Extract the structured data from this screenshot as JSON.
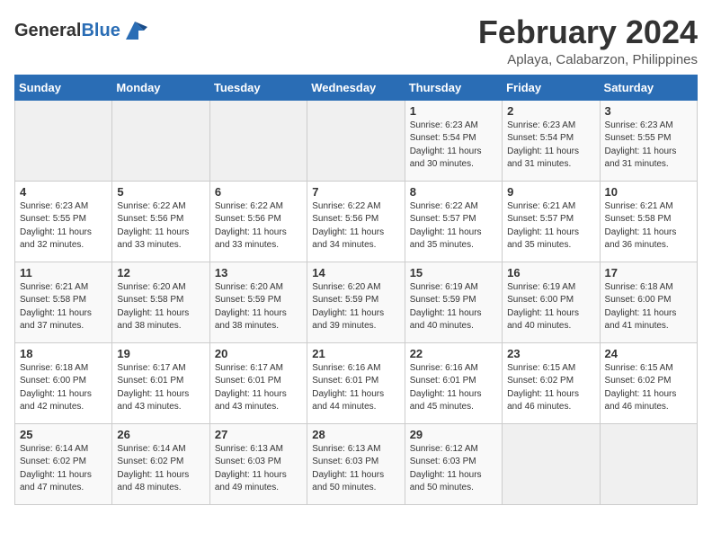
{
  "header": {
    "logo_general": "General",
    "logo_blue": "Blue",
    "title": "February 2024",
    "subtitle": "Aplaya, Calabarzon, Philippines"
  },
  "weekdays": [
    "Sunday",
    "Monday",
    "Tuesday",
    "Wednesday",
    "Thursday",
    "Friday",
    "Saturday"
  ],
  "weeks": [
    [
      {
        "day": "",
        "info": ""
      },
      {
        "day": "",
        "info": ""
      },
      {
        "day": "",
        "info": ""
      },
      {
        "day": "",
        "info": ""
      },
      {
        "day": "1",
        "info": "Sunrise: 6:23 AM\nSunset: 5:54 PM\nDaylight: 11 hours\nand 30 minutes."
      },
      {
        "day": "2",
        "info": "Sunrise: 6:23 AM\nSunset: 5:54 PM\nDaylight: 11 hours\nand 31 minutes."
      },
      {
        "day": "3",
        "info": "Sunrise: 6:23 AM\nSunset: 5:55 PM\nDaylight: 11 hours\nand 31 minutes."
      }
    ],
    [
      {
        "day": "4",
        "info": "Sunrise: 6:23 AM\nSunset: 5:55 PM\nDaylight: 11 hours\nand 32 minutes."
      },
      {
        "day": "5",
        "info": "Sunrise: 6:22 AM\nSunset: 5:56 PM\nDaylight: 11 hours\nand 33 minutes."
      },
      {
        "day": "6",
        "info": "Sunrise: 6:22 AM\nSunset: 5:56 PM\nDaylight: 11 hours\nand 33 minutes."
      },
      {
        "day": "7",
        "info": "Sunrise: 6:22 AM\nSunset: 5:56 PM\nDaylight: 11 hours\nand 34 minutes."
      },
      {
        "day": "8",
        "info": "Sunrise: 6:22 AM\nSunset: 5:57 PM\nDaylight: 11 hours\nand 35 minutes."
      },
      {
        "day": "9",
        "info": "Sunrise: 6:21 AM\nSunset: 5:57 PM\nDaylight: 11 hours\nand 35 minutes."
      },
      {
        "day": "10",
        "info": "Sunrise: 6:21 AM\nSunset: 5:58 PM\nDaylight: 11 hours\nand 36 minutes."
      }
    ],
    [
      {
        "day": "11",
        "info": "Sunrise: 6:21 AM\nSunset: 5:58 PM\nDaylight: 11 hours\nand 37 minutes."
      },
      {
        "day": "12",
        "info": "Sunrise: 6:20 AM\nSunset: 5:58 PM\nDaylight: 11 hours\nand 38 minutes."
      },
      {
        "day": "13",
        "info": "Sunrise: 6:20 AM\nSunset: 5:59 PM\nDaylight: 11 hours\nand 38 minutes."
      },
      {
        "day": "14",
        "info": "Sunrise: 6:20 AM\nSunset: 5:59 PM\nDaylight: 11 hours\nand 39 minutes."
      },
      {
        "day": "15",
        "info": "Sunrise: 6:19 AM\nSunset: 5:59 PM\nDaylight: 11 hours\nand 40 minutes."
      },
      {
        "day": "16",
        "info": "Sunrise: 6:19 AM\nSunset: 6:00 PM\nDaylight: 11 hours\nand 40 minutes."
      },
      {
        "day": "17",
        "info": "Sunrise: 6:18 AM\nSunset: 6:00 PM\nDaylight: 11 hours\nand 41 minutes."
      }
    ],
    [
      {
        "day": "18",
        "info": "Sunrise: 6:18 AM\nSunset: 6:00 PM\nDaylight: 11 hours\nand 42 minutes."
      },
      {
        "day": "19",
        "info": "Sunrise: 6:17 AM\nSunset: 6:01 PM\nDaylight: 11 hours\nand 43 minutes."
      },
      {
        "day": "20",
        "info": "Sunrise: 6:17 AM\nSunset: 6:01 PM\nDaylight: 11 hours\nand 43 minutes."
      },
      {
        "day": "21",
        "info": "Sunrise: 6:16 AM\nSunset: 6:01 PM\nDaylight: 11 hours\nand 44 minutes."
      },
      {
        "day": "22",
        "info": "Sunrise: 6:16 AM\nSunset: 6:01 PM\nDaylight: 11 hours\nand 45 minutes."
      },
      {
        "day": "23",
        "info": "Sunrise: 6:15 AM\nSunset: 6:02 PM\nDaylight: 11 hours\nand 46 minutes."
      },
      {
        "day": "24",
        "info": "Sunrise: 6:15 AM\nSunset: 6:02 PM\nDaylight: 11 hours\nand 46 minutes."
      }
    ],
    [
      {
        "day": "25",
        "info": "Sunrise: 6:14 AM\nSunset: 6:02 PM\nDaylight: 11 hours\nand 47 minutes."
      },
      {
        "day": "26",
        "info": "Sunrise: 6:14 AM\nSunset: 6:02 PM\nDaylight: 11 hours\nand 48 minutes."
      },
      {
        "day": "27",
        "info": "Sunrise: 6:13 AM\nSunset: 6:03 PM\nDaylight: 11 hours\nand 49 minutes."
      },
      {
        "day": "28",
        "info": "Sunrise: 6:13 AM\nSunset: 6:03 PM\nDaylight: 11 hours\nand 50 minutes."
      },
      {
        "day": "29",
        "info": "Sunrise: 6:12 AM\nSunset: 6:03 PM\nDaylight: 11 hours\nand 50 minutes."
      },
      {
        "day": "",
        "info": ""
      },
      {
        "day": "",
        "info": ""
      }
    ]
  ]
}
